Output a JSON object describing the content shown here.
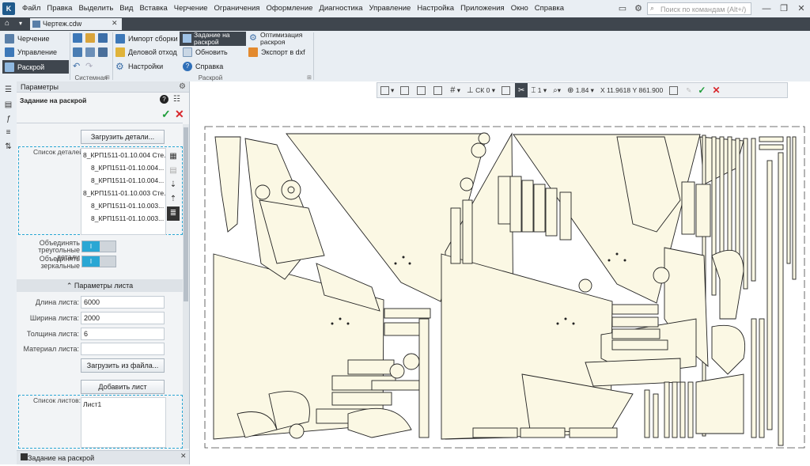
{
  "app": {
    "logo_text": "K"
  },
  "menu": [
    "Файл",
    "Правка",
    "Выделить",
    "Вид",
    "Вставка",
    "Черчение",
    "Ограничения",
    "Оформление",
    "Диагностика",
    "Управление",
    "Настройка",
    "Приложения",
    "Окно",
    "Справка"
  ],
  "search": {
    "placeholder": "Поиск по командам (Alt+/)"
  },
  "window_controls": {
    "minimize": "—",
    "maximize": "❐",
    "close": "✕"
  },
  "document_tab": {
    "name": "Чертеж.cdw",
    "close": "✕"
  },
  "ribbon": {
    "left_modes": [
      "Черчение",
      "Управление",
      "Раскрой"
    ],
    "system_group_label": "Системная",
    "cut_group_label": "Раскрой",
    "buttons": {
      "import_assembly": "Импорт сборки",
      "business_scrap": "Деловой отход",
      "settings": "Настройки",
      "cut_task_line1": "Задание на",
      "cut_task_line2": "раскрой",
      "refresh": "Обновить",
      "help": "Справка",
      "optimize_line1": "Оптимизация",
      "optimize_line2": "раскроя",
      "export_dxf": "Экспорт в dxf"
    }
  },
  "params_panel": {
    "title": "Параметры",
    "task_title": "Задание на раскрой",
    "load_parts_button": "Загрузить детали...",
    "parts_list_label": "Список деталей:",
    "parts": [
      "8_КРП1511-01.10.004 Сте...",
      "8_КРП1511-01.10.004...",
      "8_КРП1511-01.10.004...",
      "8_КРП1511-01.10.003 Сте...",
      "8_КРП1511-01.10.003...",
      "8_КРП1511-01.10.003..."
    ],
    "merge_triangular_line1": "Объединять",
    "merge_triangular_line2": "треугольные детали",
    "merge_mirror_line1": "Объединять",
    "merge_mirror_line2": "зеркальные",
    "sheet_params_header": "Параметры листа",
    "sheet_length_label": "Длина листа:",
    "sheet_length": "6000",
    "sheet_width_label": "Ширина листа:",
    "sheet_width": "2000",
    "sheet_thickness_label": "Толщина листа:",
    "sheet_thickness": "6",
    "sheet_material_label": "Материал листа:",
    "sheet_material": "",
    "load_from_file_button": "Загрузить из файла...",
    "add_sheet_button": "Добавить лист",
    "sheets_list_label": "Список листов:",
    "sheets": [
      "Лист1"
    ]
  },
  "cad_toolbar": {
    "cs": "СК 0",
    "step": "1",
    "zoom": "1.84",
    "x_label": "X",
    "x_value": "11.9618",
    "y_label": "Y",
    "y_value": "861.900"
  },
  "status": {
    "text": "Задание на раскрой"
  },
  "colors": {
    "accent": "#2aa7d4",
    "ok": "#1f9d3a",
    "cancel": "#d8262b",
    "part_fill": "#fbf8e4"
  }
}
